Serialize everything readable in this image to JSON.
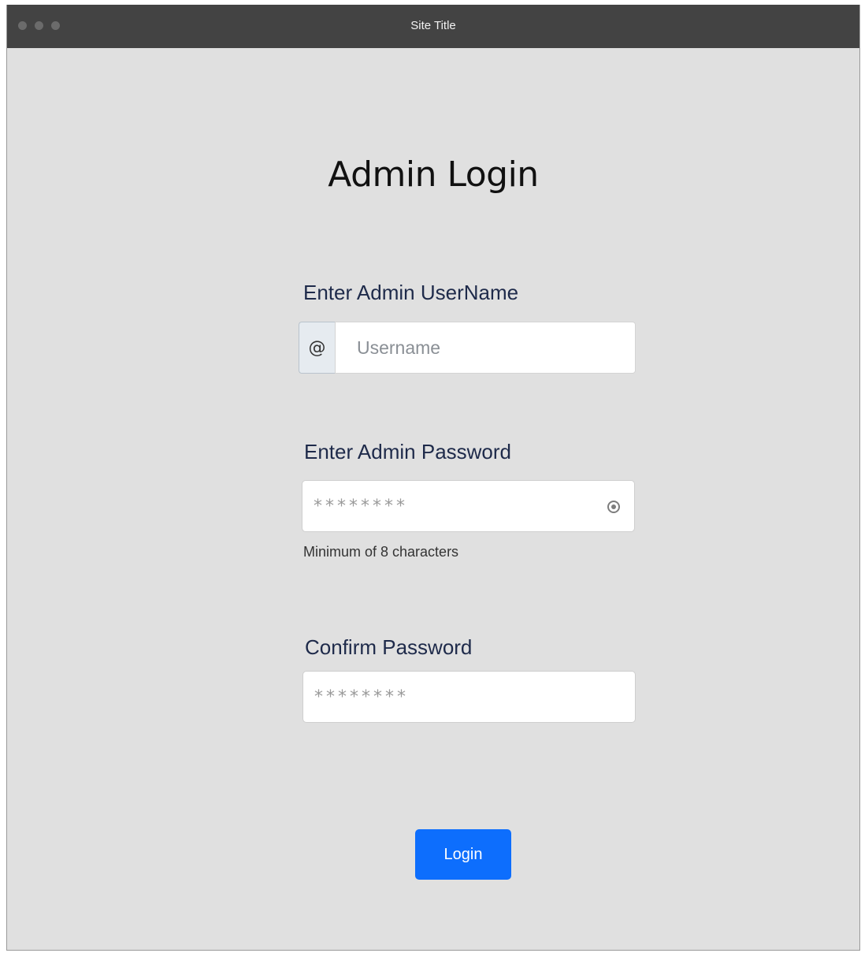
{
  "window": {
    "title": "Site Title"
  },
  "page": {
    "heading": "Admin Login"
  },
  "username": {
    "label": "Enter Admin UserName",
    "addon": "@",
    "placeholder": "Username",
    "value": ""
  },
  "password": {
    "label": "Enter Admin Password",
    "masked_value": "********",
    "hint": "Minimum of 8 characters",
    "toggle_icon": "eye-icon"
  },
  "confirm_password": {
    "label": "Confirm Password",
    "masked_value": "********"
  },
  "actions": {
    "login_label": "Login"
  },
  "colors": {
    "titlebar": "#434343",
    "background": "#e0e0e0",
    "label_text": "#1e2a4a",
    "primary_button": "#0d6efd"
  }
}
